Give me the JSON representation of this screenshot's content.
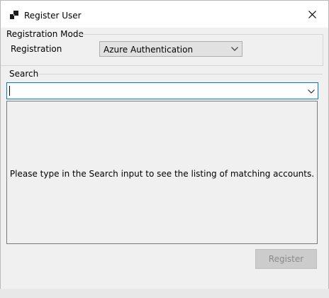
{
  "window": {
    "title": "Register User"
  },
  "registration_mode": {
    "group_label": "Registration Mode",
    "field_label": "Registration",
    "selected": "Azure Authentication"
  },
  "search": {
    "group_label": "Search",
    "value": ""
  },
  "results": {
    "hint": "Please type in the Search input to see the listing of matching accounts."
  },
  "actions": {
    "register_label": "Register"
  },
  "colors": {
    "focus_border": "#0078d7",
    "disabled_text": "#8a8a8a",
    "window_bg": "#f0f0f0"
  },
  "icons": [
    "app-icon",
    "close-icon",
    "chevron-down-icon"
  ]
}
